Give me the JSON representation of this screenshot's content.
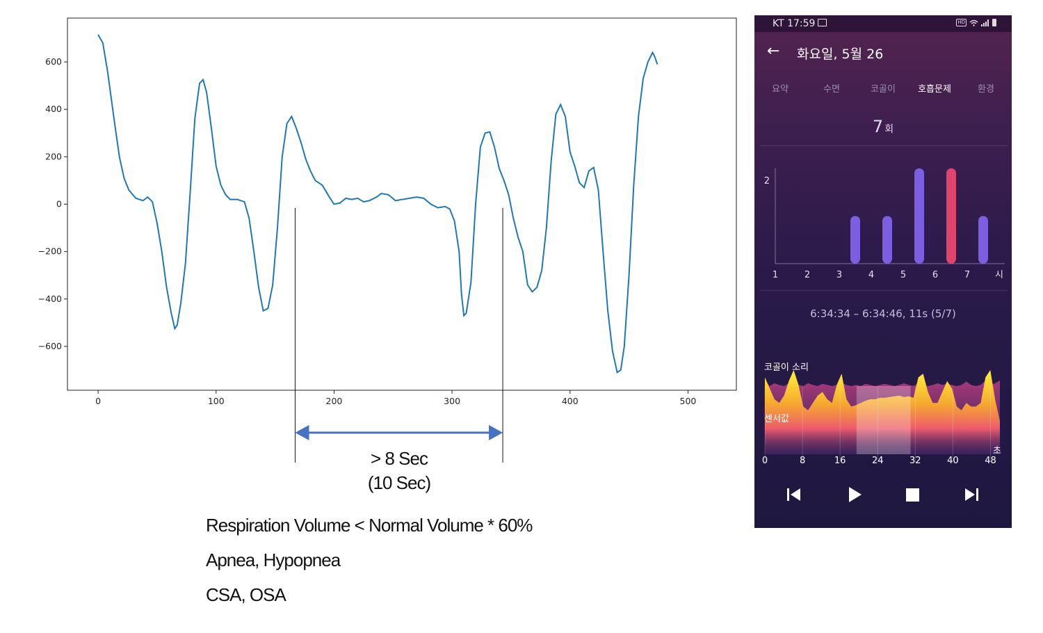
{
  "chart_data": [
    {
      "type": "line",
      "title": "",
      "xlabel": "",
      "ylabel": "",
      "xlim": [
        -26,
        541
      ],
      "ylim": [
        -785,
        785
      ],
      "x_ticks": [
        0,
        100,
        200,
        300,
        400,
        500
      ],
      "y_ticks": [
        600,
        400,
        200,
        0,
        -200,
        -400,
        -600
      ],
      "grid": false,
      "series": [
        {
          "color": "#1f77b4",
          "points": [
            [
              0,
              715
            ],
            [
              4,
              680
            ],
            [
              8,
              560
            ],
            [
              14,
              340
            ],
            [
              18,
              200
            ],
            [
              22,
              110
            ],
            [
              26,
              60
            ],
            [
              32,
              25
            ],
            [
              38,
              15
            ],
            [
              42,
              30
            ],
            [
              46,
              10
            ],
            [
              50,
              -80
            ],
            [
              54,
              -200
            ],
            [
              58,
              -350
            ],
            [
              62,
              -460
            ],
            [
              65,
              -525
            ],
            [
              67,
              -510
            ],
            [
              70,
              -420
            ],
            [
              74,
              -250
            ],
            [
              78,
              50
            ],
            [
              82,
              360
            ],
            [
              86,
              510
            ],
            [
              89,
              525
            ],
            [
              92,
              470
            ],
            [
              96,
              320
            ],
            [
              100,
              160
            ],
            [
              104,
              80
            ],
            [
              108,
              40
            ],
            [
              112,
              20
            ],
            [
              118,
              20
            ],
            [
              124,
              10
            ],
            [
              128,
              -60
            ],
            [
              132,
              -200
            ],
            [
              136,
              -350
            ],
            [
              140,
              -450
            ],
            [
              144,
              -440
            ],
            [
              148,
              -340
            ],
            [
              152,
              -100
            ],
            [
              156,
              200
            ],
            [
              160,
              340
            ],
            [
              164,
              370
            ],
            [
              168,
              320
            ],
            [
              172,
              260
            ],
            [
              176,
              190
            ],
            [
              180,
              140
            ],
            [
              184,
              100
            ],
            [
              190,
              80
            ],
            [
              196,
              30
            ],
            [
              200,
              0
            ],
            [
              205,
              5
            ],
            [
              210,
              25
            ],
            [
              215,
              20
            ],
            [
              220,
              25
            ],
            [
              225,
              10
            ],
            [
              230,
              15
            ],
            [
              236,
              30
            ],
            [
              240,
              45
            ],
            [
              246,
              40
            ],
            [
              252,
              15
            ],
            [
              258,
              20
            ],
            [
              264,
              25
            ],
            [
              270,
              30
            ],
            [
              276,
              25
            ],
            [
              282,
              0
            ],
            [
              288,
              -15
            ],
            [
              294,
              -10
            ],
            [
              298,
              -20
            ],
            [
              302,
              -70
            ],
            [
              306,
              -200
            ],
            [
              308,
              -380
            ],
            [
              310,
              -470
            ],
            [
              312,
              -460
            ],
            [
              316,
              -330
            ],
            [
              320,
              0
            ],
            [
              324,
              240
            ],
            [
              328,
              300
            ],
            [
              332,
              305
            ],
            [
              336,
              240
            ],
            [
              340,
              150
            ],
            [
              344,
              100
            ],
            [
              348,
              40
            ],
            [
              352,
              -60
            ],
            [
              356,
              -140
            ],
            [
              360,
              -200
            ],
            [
              364,
              -340
            ],
            [
              368,
              -370
            ],
            [
              372,
              -350
            ],
            [
              376,
              -280
            ],
            [
              380,
              -100
            ],
            [
              384,
              180
            ],
            [
              388,
              380
            ],
            [
              392,
              420
            ],
            [
              396,
              370
            ],
            [
              400,
              220
            ],
            [
              404,
              160
            ],
            [
              408,
              90
            ],
            [
              412,
              70
            ],
            [
              416,
              140
            ],
            [
              420,
              155
            ],
            [
              424,
              60
            ],
            [
              428,
              -200
            ],
            [
              432,
              -450
            ],
            [
              436,
              -620
            ],
            [
              440,
              -710
            ],
            [
              443,
              -700
            ],
            [
              446,
              -600
            ],
            [
              450,
              -300
            ],
            [
              454,
              80
            ],
            [
              458,
              370
            ],
            [
              462,
              530
            ],
            [
              466,
              600
            ],
            [
              470,
              640
            ],
            [
              472,
              620
            ],
            [
              474,
              590
            ]
          ]
        }
      ],
      "annotations": {
        "interval_text_line1": "> 8 Sec",
        "interval_text_line2": "(10 Sec)",
        "interval_start_x": 167,
        "interval_end_x": 343
      }
    },
    {
      "type": "bar",
      "title": "",
      "categories": [
        "1",
        "2",
        "3",
        "4",
        "5",
        "6",
        "7",
        "시"
      ],
      "ylim": [
        0,
        2
      ],
      "y_ticks": [
        "2"
      ],
      "bars": [
        {
          "hour": 3.5,
          "value": 1,
          "color": "#7b5fe0"
        },
        {
          "hour": 4.5,
          "value": 1,
          "color": "#7b5fe0"
        },
        {
          "hour": 5.5,
          "value": 2,
          "color": "#7b5fe0"
        },
        {
          "hour": 6.5,
          "value": 2,
          "color": "#e0436b"
        },
        {
          "hour": 7.5,
          "value": 1,
          "color": "#7b5fe0"
        }
      ]
    },
    {
      "type": "area",
      "title": "",
      "x_unit_label": "초",
      "x_ticks": [
        "0",
        "8",
        "16",
        "24",
        "32",
        "40",
        "48"
      ],
      "xlim": [
        0,
        50
      ],
      "series": [
        {
          "name": "코골이 소리",
          "color": "#c2477e",
          "values": [
            0.2,
            0.1,
            0.15,
            0.12,
            0.1,
            0.15,
            0.1,
            0.12,
            0.1,
            0.15,
            0.12,
            0.1,
            0.14,
            0.12,
            0.1,
            0.12,
            0.15,
            0.12,
            0.1,
            0.12,
            0.1,
            0.14,
            0.12,
            0.1,
            0.12,
            0.14,
            0.12,
            0.1,
            0.12,
            0.15,
            0.12,
            0.1,
            0.15,
            0.12,
            0.1,
            0.12,
            0.15,
            0.12,
            0.14,
            0.12,
            0.1,
            0.12,
            0.18,
            0.12,
            0.1,
            0.12,
            0.2,
            0.12,
            0.15,
            0.2
          ]
        },
        {
          "name": "센서값",
          "color": "#f2c52a",
          "values": [
            0.9,
            0.75,
            0.6,
            0.55,
            0.65,
            0.85,
            1.0,
            0.8,
            0.5,
            0.45,
            0.55,
            0.65,
            0.7,
            0.6,
            0.55,
            0.8,
            0.95,
            0.6,
            0.5,
            0.52,
            0.55,
            0.58,
            0.6,
            0.6,
            0.62,
            0.62,
            0.63,
            0.64,
            0.65,
            0.63,
            0.64,
            0.62,
            0.9,
            0.95,
            0.7,
            0.55,
            0.55,
            0.7,
            0.85,
            0.75,
            0.5,
            0.45,
            0.55,
            0.5,
            0.5,
            0.55,
            0.9,
            1.0,
            0.6,
            0.3
          ]
        }
      ],
      "highlight_range": [
        19.5,
        31
      ]
    }
  ],
  "notes": {
    "line1": "Respiration Volume < Normal Volume * 60%",
    "line2": "Apnea, Hypopnea",
    "line3": "CSA, OSA"
  },
  "phone": {
    "status": {
      "carrier_time": "KT 17:59",
      "hd": "HD"
    },
    "header": {
      "back_icon": "arrow-left-icon",
      "title": "화요일, 5월 26"
    },
    "tabs": [
      {
        "label": "요약",
        "active": false
      },
      {
        "label": "수면",
        "active": false
      },
      {
        "label": "코골이",
        "active": false
      },
      {
        "label": "호흡문제",
        "active": true
      },
      {
        "label": "환경",
        "active": false
      }
    ],
    "count": {
      "value": "7",
      "unit": "회"
    },
    "event_range": "6:34:34 – 6:34:46, 11s (5/7)",
    "controls": [
      "skip-previous-icon",
      "play-icon",
      "stop-icon",
      "skip-next-icon"
    ],
    "colors": {
      "bar_normal": "#7b5fe0",
      "bar_selected": "#e0436b",
      "background": "#2a1a4a"
    }
  }
}
